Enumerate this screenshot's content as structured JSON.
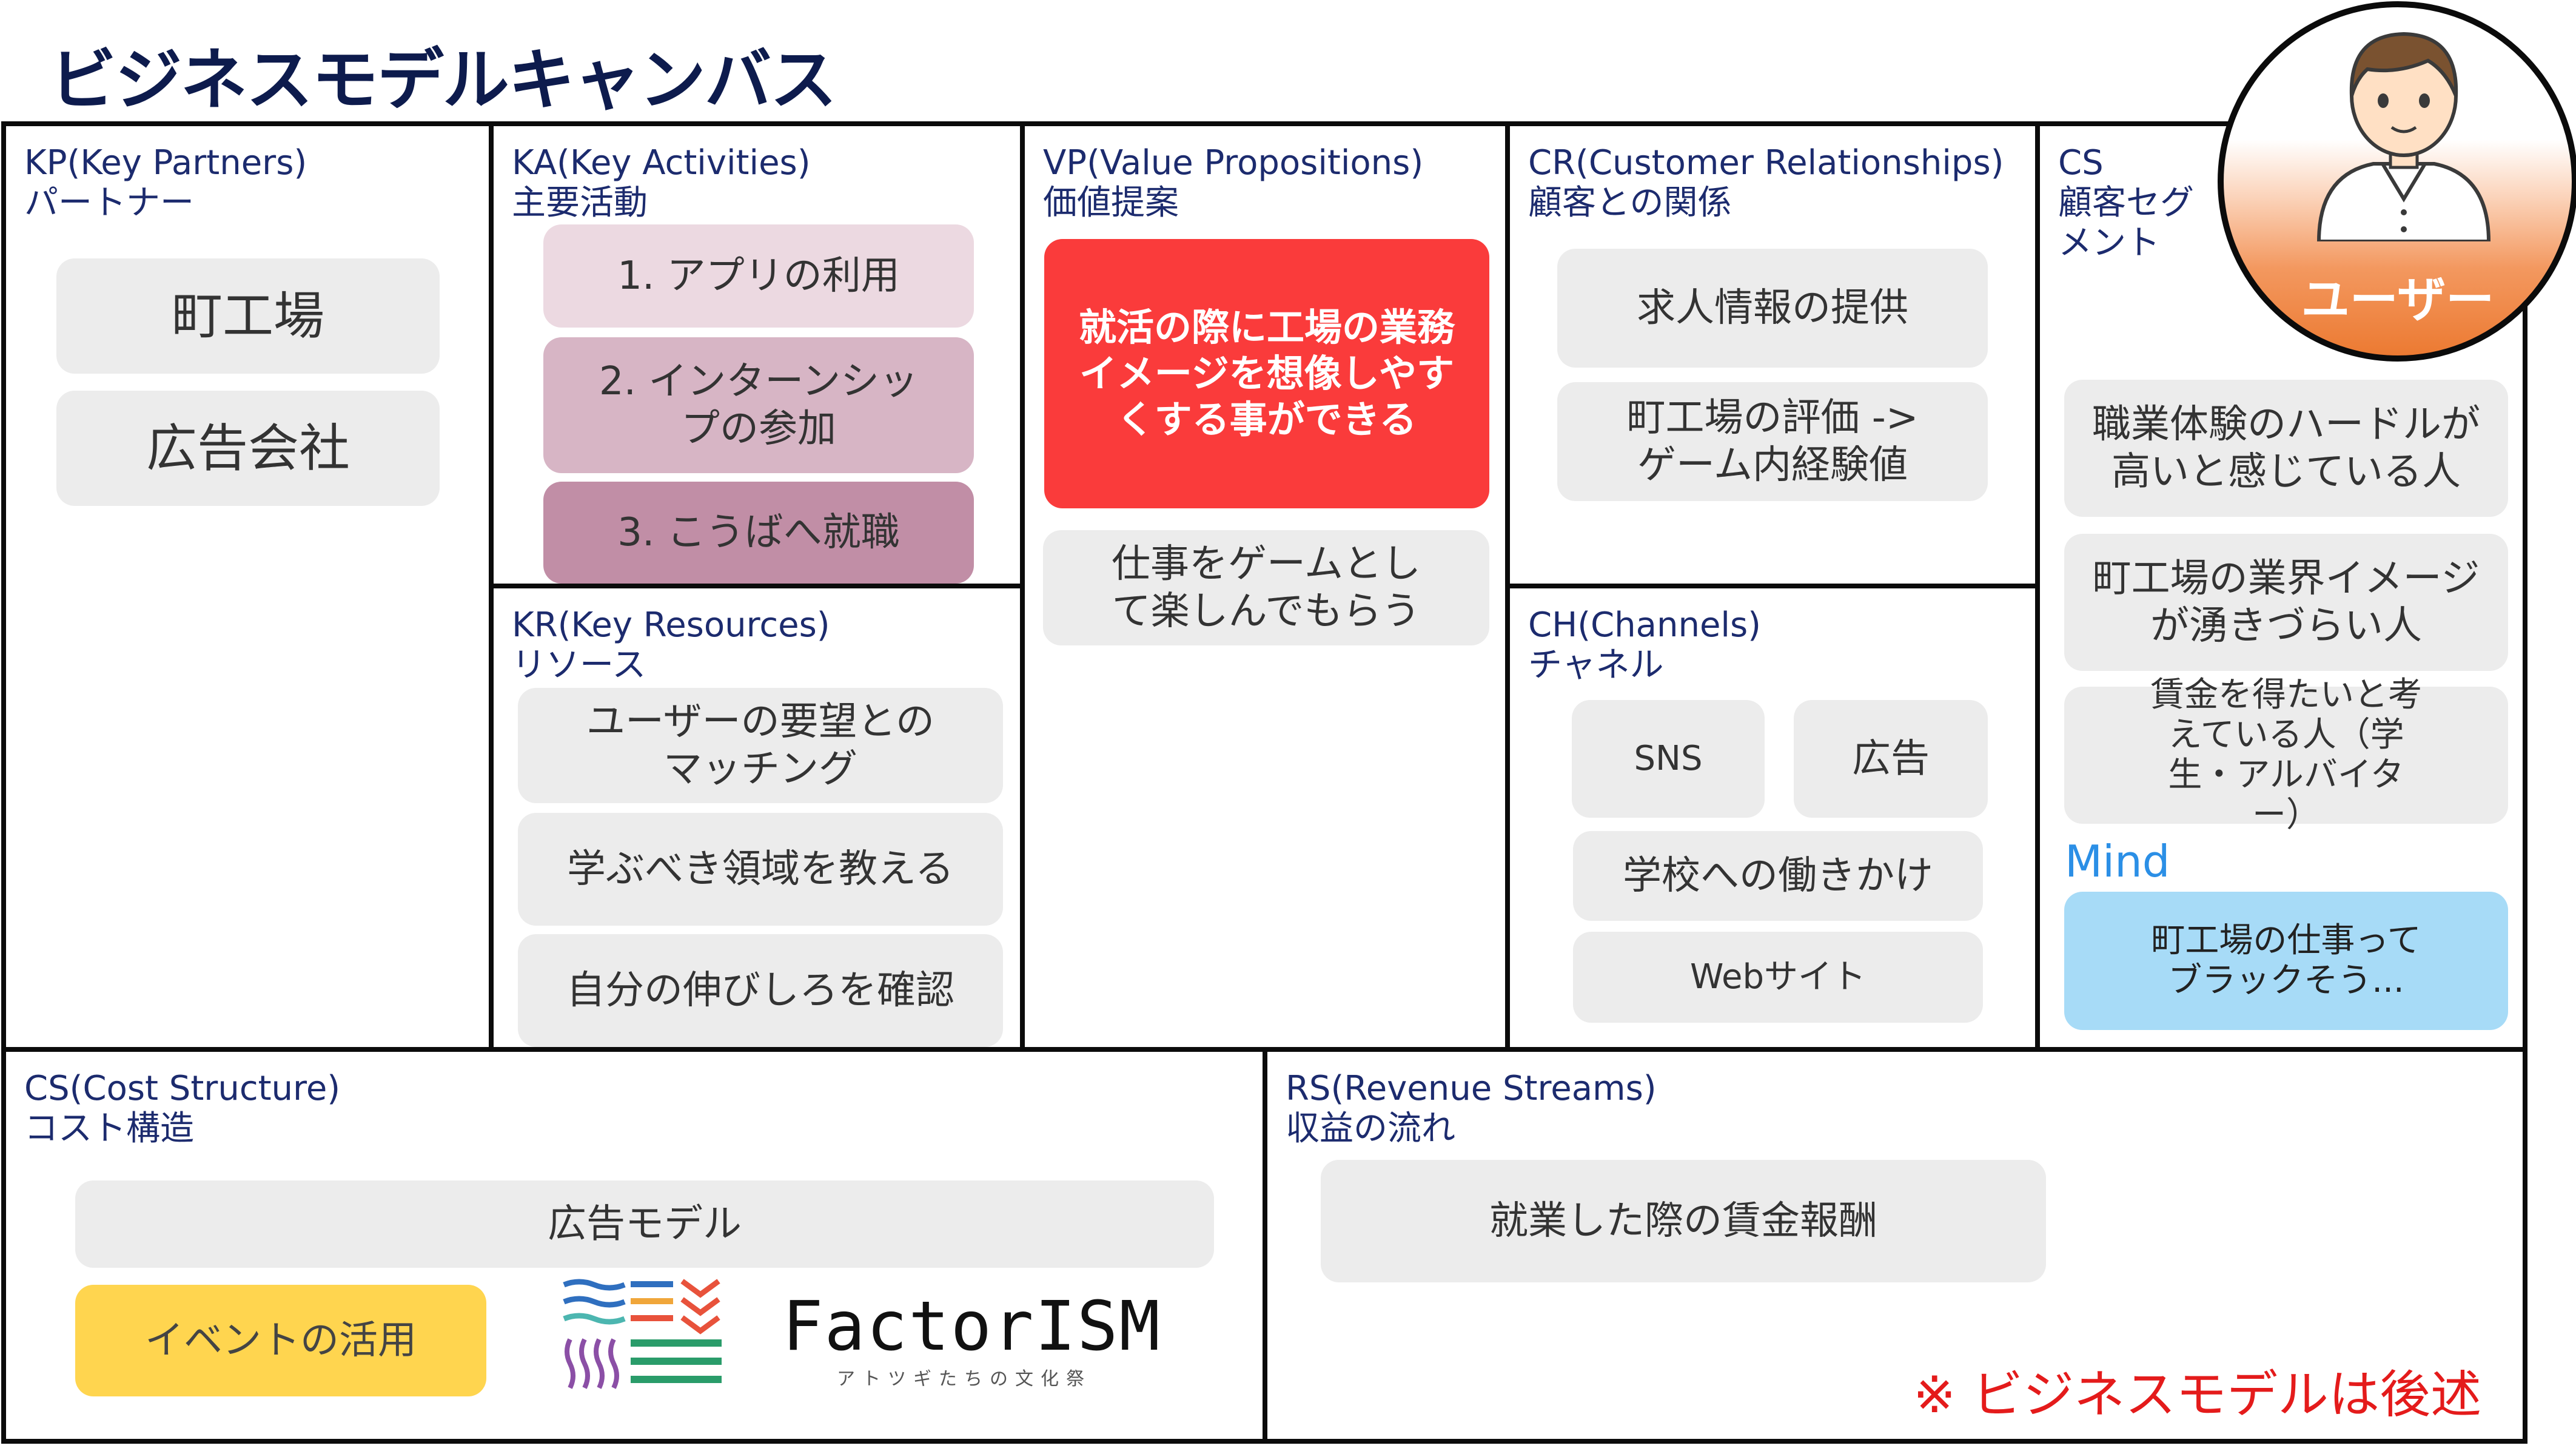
{
  "title": "ビジネスモデルキャンバス",
  "kp": {
    "label_en": "KP(Key Partners)",
    "label_ja": "パートナー",
    "items": [
      "町工場",
      "広告会社"
    ]
  },
  "ka": {
    "label_en": "KA(Key Activities)",
    "label_ja": "主要活動",
    "items": [
      "1. アプリの利用",
      "2. インターンシップの参加",
      "3. こうばへ就職"
    ]
  },
  "kr": {
    "label_en": "KR(Key Resources)",
    "label_ja": "リソース",
    "items": [
      "ユーザーの要望とのマッチング",
      "学ぶべき領域を教える",
      "自分の伸びしろを確認"
    ]
  },
  "vp": {
    "label_en": "VP(Value Propositions)",
    "label_ja": "価値提案",
    "main": "就活の際に工場の業務イメージを想像しやすくする事ができる",
    "sub": "仕事をゲームとして楽しんでもらう"
  },
  "cr": {
    "label_en": "CR(Customer Relationships)",
    "label_ja": "顧客との関係",
    "items": [
      "求人情報の提供",
      "町工場の評価 -> ゲーム内経験値"
    ]
  },
  "ch": {
    "label_en": "CH(Channels)",
    "label_ja": "チャネル",
    "items": [
      "SNS",
      "広告",
      "学校への働きかけ",
      "Webサイト"
    ]
  },
  "cs": {
    "label_en": "CS",
    "label_ja": "顧客セグメント",
    "items": [
      "職業体験のハードルが高いと感じている人",
      "町工場の業界イメージが湧きづらい人",
      "賃金を得たいと考えている人（学生・アルバイター）"
    ],
    "mind_label": "Mind",
    "mind_text": "町工場の仕事ってブラックそう..."
  },
  "user": {
    "label": "ユーザー"
  },
  "cost": {
    "label_en": "CS(Cost Structure)",
    "label_ja": "コスト構造",
    "items": [
      "広告モデル",
      "イベントの活用"
    ]
  },
  "logo": {
    "name": "FactorISM",
    "subtitle": "アトツギたちの文化祭"
  },
  "revenue": {
    "label_en": "RS(Revenue Streams)",
    "label_ja": "収益の流れ",
    "items": [
      "就業した際の賃金報酬"
    ]
  },
  "note": "※ ビジネスモデルは後述",
  "colors": {
    "title": "#0d1b4d",
    "label": "#1c2b6e",
    "vp_main": "#fa3b3b",
    "mind": "#2b8fe6",
    "mind_box": "#a7dbf7",
    "event_box": "#ffd54f",
    "note": "#e41b1b",
    "user_orange": "#ec7a32"
  }
}
